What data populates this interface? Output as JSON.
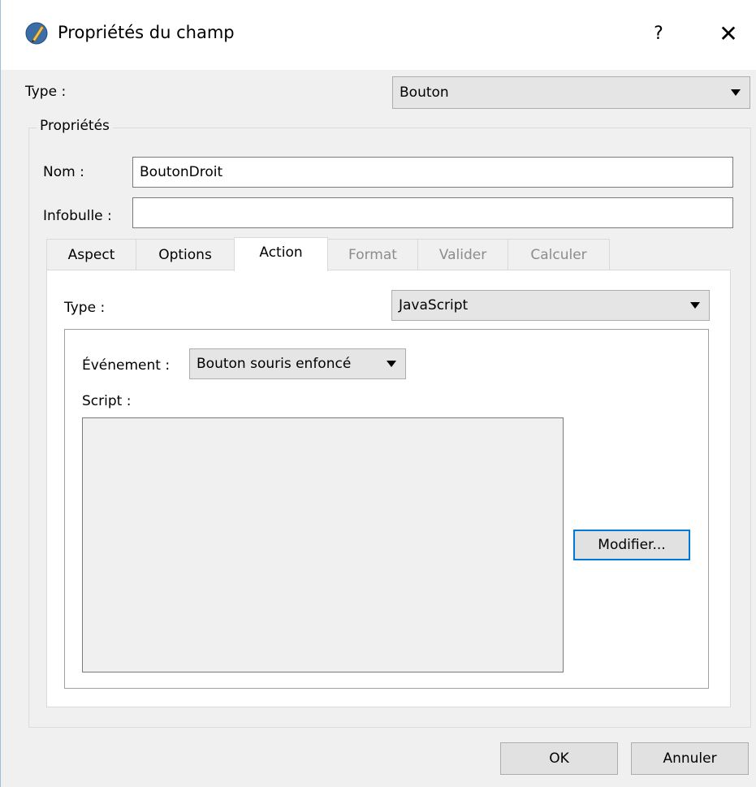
{
  "window": {
    "title": "Propriétés du champ",
    "help_label": "?",
    "close_label": "✕"
  },
  "field_type": {
    "label": "Type :",
    "value": "Bouton"
  },
  "properties": {
    "group_title": "Propriétés",
    "name_label": "Nom :",
    "name_value": "BoutonDroit",
    "tooltip_label": "Infobulle :",
    "tooltip_value": ""
  },
  "tabs": [
    {
      "label": "Aspect",
      "state": "normal"
    },
    {
      "label": "Options",
      "state": "normal"
    },
    {
      "label": "Action",
      "state": "active"
    },
    {
      "label": "Format",
      "state": "disabled"
    },
    {
      "label": "Valider",
      "state": "disabled"
    },
    {
      "label": "Calculer",
      "state": "disabled"
    }
  ],
  "action": {
    "type_label": "Type :",
    "type_value": "JavaScript",
    "event_label": "Événement :",
    "event_value": "Bouton souris enfoncé",
    "script_label": "Script :",
    "script_value": "",
    "modify_button": "Modifier..."
  },
  "footer": {
    "ok_button": "OK",
    "cancel_button": "Annuler"
  },
  "colors": {
    "focus_accent": "#0078d7",
    "dialog_bg": "#f0f0f0"
  },
  "icons": {
    "app": "pdf-editor-app-icon",
    "dropdown": "chevron-down-icon"
  }
}
